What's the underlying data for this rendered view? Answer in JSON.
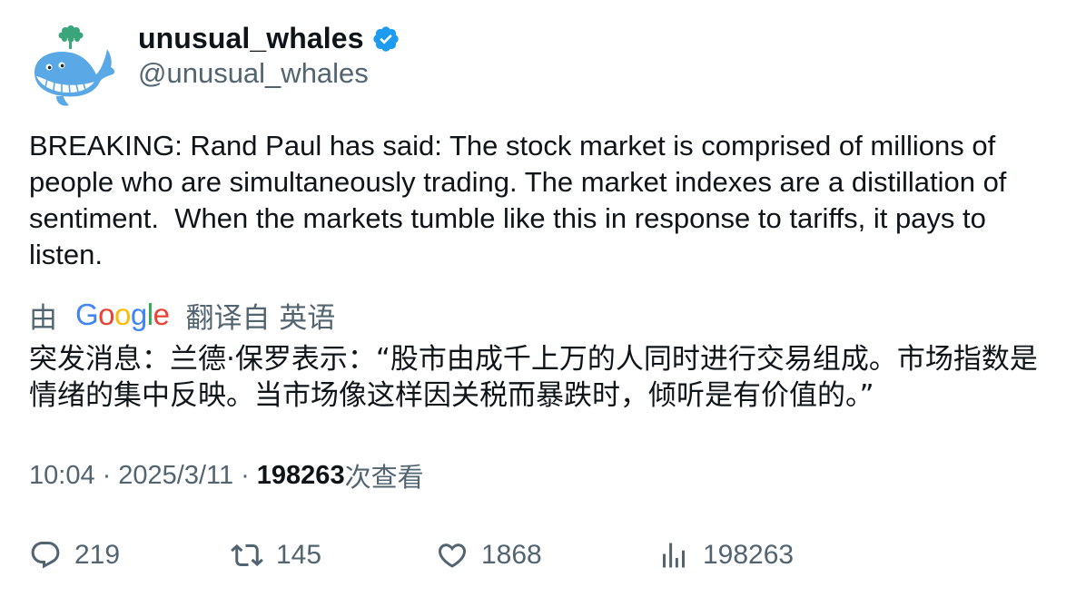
{
  "author": {
    "name": "unusual_whales",
    "handle": "@unusual_whales",
    "avatar_icon": "whale-logo-icon",
    "verified_color": "#1d9bf0"
  },
  "tweet": {
    "text": "BREAKING: Rand Paul has said: The stock market is comprised of millions of people who are simultaneously trading. The market indexes are a distillation of sentiment.  When the markets tumble like this in response to tariffs, it pays to listen."
  },
  "translation": {
    "prefix": "由",
    "provider": "Google",
    "suffix": "翻译自 英语",
    "text": "突发消息：兰德·保罗表示：“股市由成千上万的人同时进行交易组成。市场指数是情绪的集中反映。当市场像这样因关税而暴跌时，倾听是有价值的。”"
  },
  "meta": {
    "time": "10:04",
    "sep1": "·",
    "date": "2025/3/11",
    "sep2": "·",
    "views": "198263",
    "views_label": "次查看"
  },
  "actions": {
    "replies": "219",
    "retweets": "145",
    "likes": "1868",
    "views": "198263"
  }
}
